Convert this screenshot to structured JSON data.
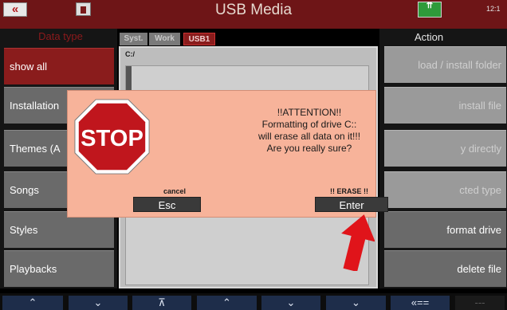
{
  "titlebar": {
    "back_label": "«",
    "title": "USB Media",
    "status_label": "",
    "status_glyph": "⇈",
    "time": "12:1"
  },
  "headers": {
    "left": "Data type",
    "right": "Action"
  },
  "left_buttons": [
    {
      "label": "show all"
    },
    {
      "label": "Installation"
    },
    {
      "label": "Themes (A"
    },
    {
      "label": "Songs"
    },
    {
      "label": "Styles"
    },
    {
      "label": "Playbacks"
    }
  ],
  "right_buttons": [
    {
      "label": "load  /  install  folder"
    },
    {
      "label": "install  file"
    },
    {
      "label": "y  directly"
    },
    {
      "label": "cted  type"
    },
    {
      "label": "format  drive"
    },
    {
      "label": "delete  file"
    }
  ],
  "tabs": [
    {
      "label": "Syst."
    },
    {
      "label": "Work"
    },
    {
      "label": "USB1"
    }
  ],
  "browser": {
    "path": "C:/"
  },
  "bottom_bar": [
    {
      "label": "⌃"
    },
    {
      "label": "⌄"
    },
    {
      "label": "⊼"
    },
    {
      "label": "⌃"
    },
    {
      "label": "⌄"
    },
    {
      "label": "⌄"
    },
    {
      "label": "«=="
    },
    {
      "label": "---"
    }
  ],
  "dialog": {
    "stop_text": "STOP",
    "line1": "!!ATTENTION!!",
    "line2": "Formatting of drive C::",
    "line3": "will erase all data on it!!!",
    "line4": "Are you really sure?",
    "cancel_caption": "cancel",
    "esc_label": "Esc",
    "erase_caption": "!! ERASE !!",
    "enter_label": "Enter"
  },
  "colors": {
    "titlebar": "#6e1517",
    "dialog_bg": "#f7b39a",
    "stop_red": "#c0161d",
    "arrow": "#e0141a",
    "active_button": "#8a1c1c"
  }
}
